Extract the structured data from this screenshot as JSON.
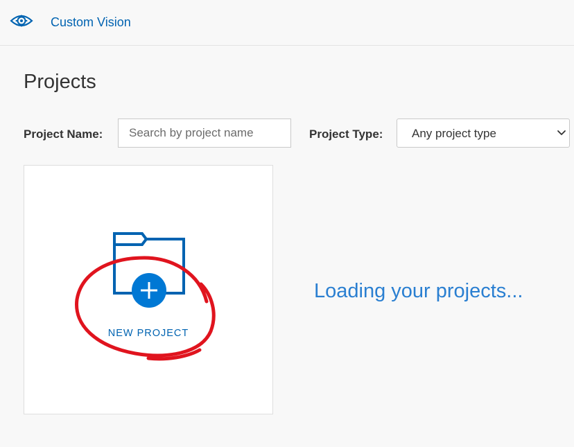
{
  "header": {
    "app_title": "Custom Vision",
    "logo_icon": "eye-gear-icon"
  },
  "page": {
    "title": "Projects"
  },
  "filters": {
    "name_label": "Project Name:",
    "name_placeholder": "Search by project name",
    "name_value": "",
    "type_label": "Project Type:",
    "type_selected": "Any project type"
  },
  "new_project_card": {
    "label": "NEW PROJECT",
    "icon": "folder-add-icon"
  },
  "status": {
    "loading_text": "Loading your projects..."
  },
  "colors": {
    "brand": "#0063b1",
    "accent": "#0078d4",
    "annotation": "#e0141e"
  }
}
